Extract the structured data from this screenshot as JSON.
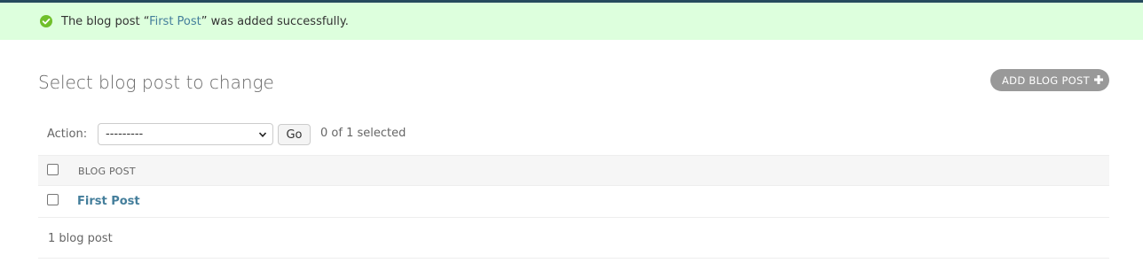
{
  "message": {
    "prefix": "The blog post “",
    "link_text": "First Post",
    "suffix": "” was added successfully.",
    "icon": "check-circle-icon",
    "color": "#70bf2b"
  },
  "page": {
    "title": "Select blog post to change",
    "add_button_label": "ADD BLOG POST",
    "add_icon": "plus-icon"
  },
  "actions": {
    "label": "Action:",
    "select_value": "---------",
    "go_label": "Go",
    "selected_text": "0 of 1 selected"
  },
  "table": {
    "columns": [
      "BLOG POST"
    ],
    "rows": [
      {
        "title": "First Post"
      }
    ]
  },
  "paginator": {
    "count_text": "1 blog post"
  },
  "colors": {
    "header_stripe": "#264b5d",
    "message_background": "#dfd",
    "link": "#447e9b",
    "add_button": "#999999"
  }
}
